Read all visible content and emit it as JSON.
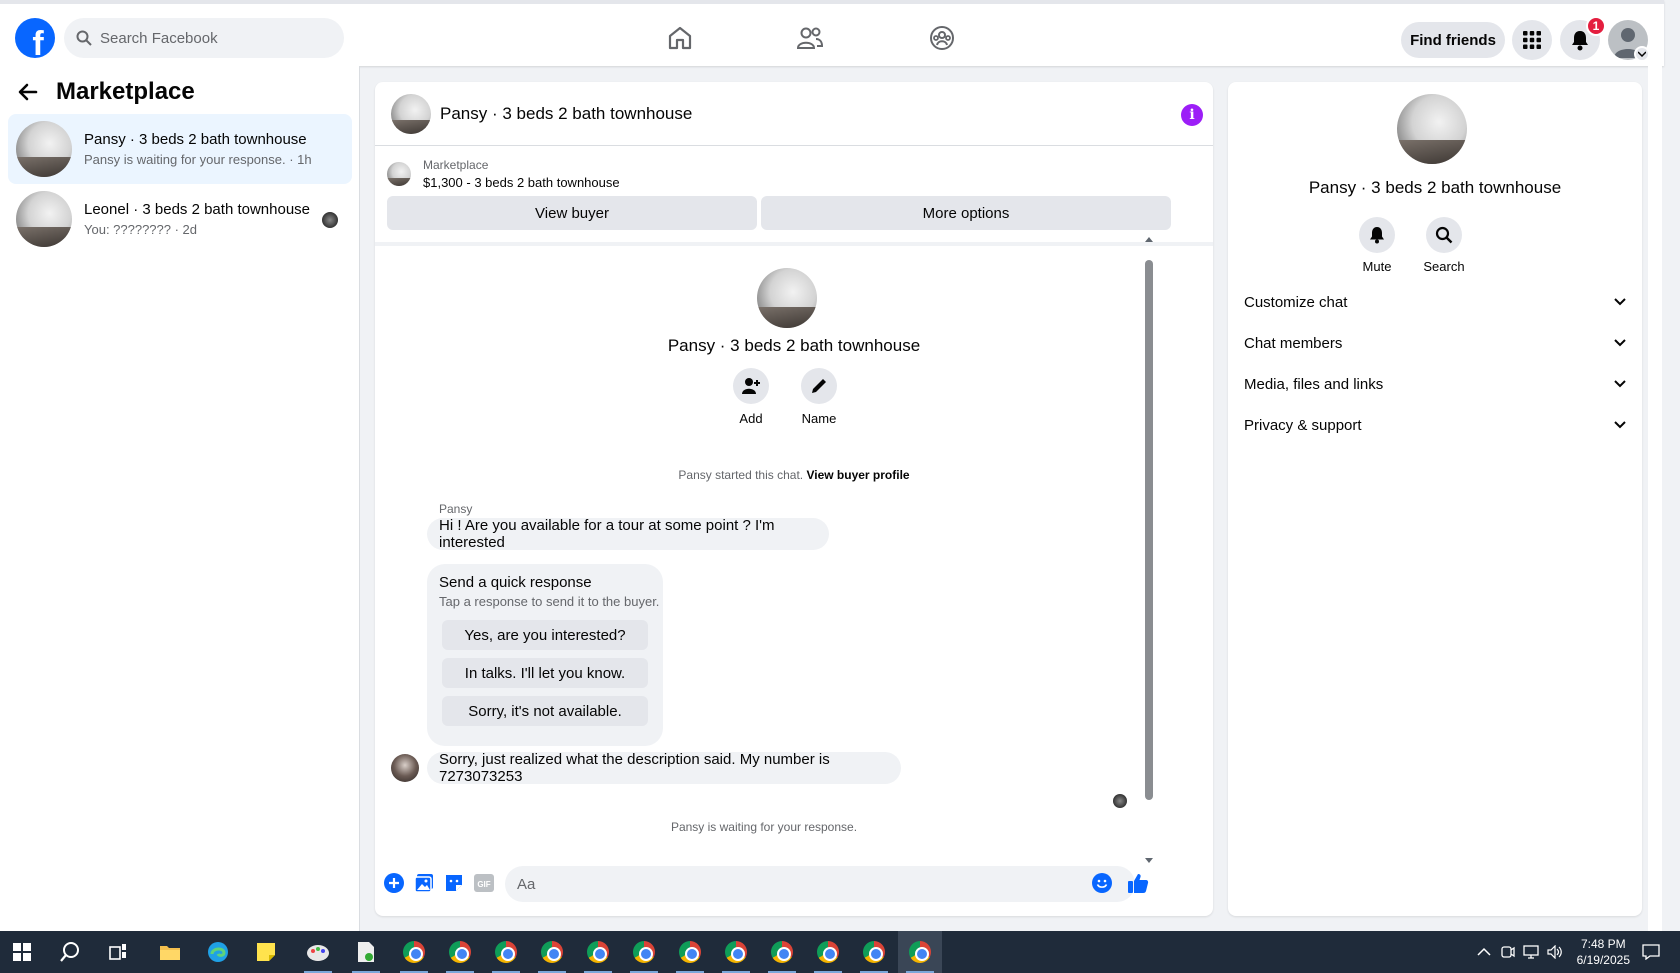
{
  "topbar": {
    "logo": "f",
    "search_placeholder": "Search Facebook",
    "find_friends": "Find friends",
    "notification_count": "1",
    "icons": [
      "facebook-logo",
      "search-icon",
      "home-icon",
      "friends-icon",
      "groups-icon",
      "menu-grid-icon",
      "bell-icon",
      "profile-avatar",
      "chevron-down-icon"
    ]
  },
  "sidebar": {
    "title": "Marketplace",
    "conversations": [
      {
        "title": "Pansy · 3 beds 2 bath townhouse",
        "subtitle": "Pansy is waiting for your response. · 1h",
        "active": true
      },
      {
        "title": "Leonel · 3 beds 2 bath townhouse",
        "subtitle": "You: ???????? · 2d",
        "active": false
      }
    ]
  },
  "chat": {
    "title": "Pansy · 3 beds 2 bath townhouse",
    "listing_label": "Marketplace",
    "listing_value": "$1,300 - 3 beds 2 bath townhouse",
    "view_buyer": "View buyer",
    "more_options": "More options",
    "center_title": "Pansy · 3 beds 2 bath townhouse",
    "add_label": "Add",
    "name_label": "Name",
    "started_text": "Pansy started this chat. ",
    "view_buyer_profile": "View buyer profile",
    "sender_name": "Pansy",
    "message1": "Hi ! Are you available for a tour at some point ? I'm interested",
    "quick_title": "Send a quick response",
    "quick_subtitle": "Tap a response to send it to the buyer.",
    "quick_responses": [
      "Yes, are you interested?",
      "In talks. I'll let you know.",
      "Sorry, it's not available."
    ],
    "message2": "Sorry, just realized what the description said. My number is 7273073253",
    "waiting_text": "Pansy is waiting for your response.",
    "composer_placeholder": "Aa"
  },
  "right_panel": {
    "title": "Pansy · 3 beds 2 bath townhouse",
    "mute_label": "Mute",
    "search_label": "Search",
    "sections": [
      "Customize chat",
      "Chat members",
      "Media, files and links",
      "Privacy & support"
    ]
  },
  "taskbar": {
    "time": "7:48 PM",
    "date": "6/19/2025"
  },
  "colors": {
    "brand_blue": "#0866ff",
    "active_conversation": "#ebf5ff",
    "info_purple": "#9c1ef7",
    "badge_red": "#e41e3f"
  }
}
